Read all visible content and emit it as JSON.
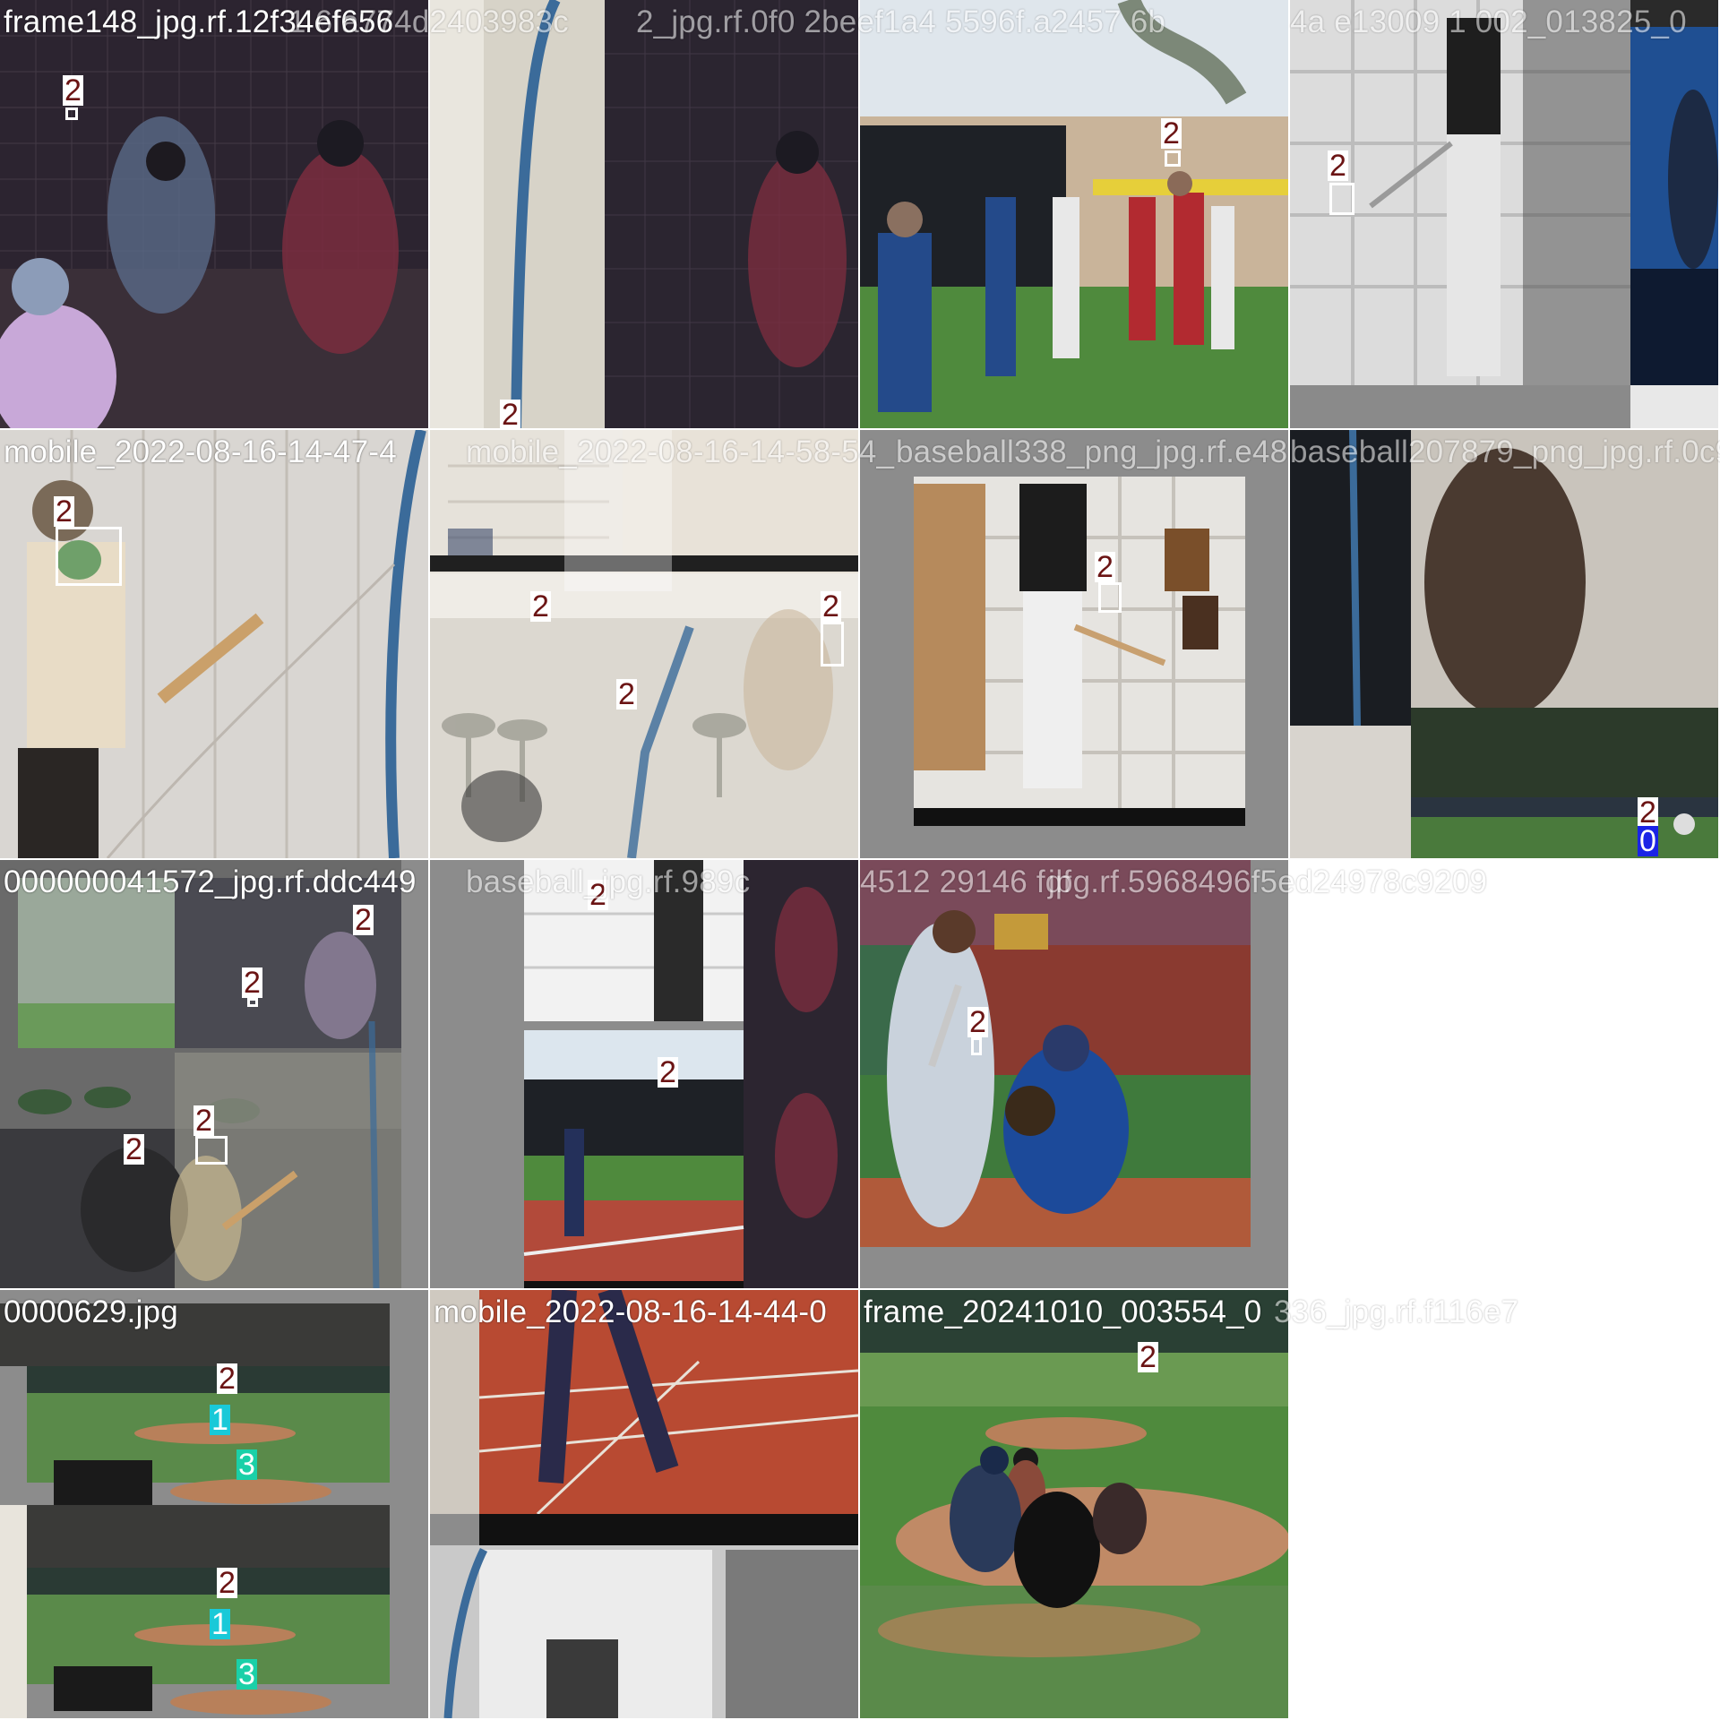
{
  "colors": {
    "class_2": "#ffffff",
    "class_2_text": "#6b1414",
    "class_0": "#1a24e6",
    "class_1": "#19c9d8",
    "class_3": "#1ad0a8",
    "pad_gray": "#8c8c8c"
  },
  "classes": {
    "c0": "0",
    "c1": "1",
    "c2": "2",
    "c3": "3"
  },
  "tiles": [
    {
      "filename": "frame148_jpg.rf.12f34ef656",
      "ghost": "1 6fa774d2403983c"
    },
    {
      "filename": "",
      "ghost": "2_jpg.rf.0f0 2beef1a4 5596f.a2457 6b"
    },
    {
      "filename": "",
      "ghost": "4a e13009 1 002_013825_0"
    },
    {
      "filename": "",
      "ghost": ""
    },
    {
      "filename": "mobile_2022-08-16-14-47-4",
      "ghost": "mobile_2022-08-16-14-58-54_"
    },
    {
      "filename": "",
      "ghost": "baseball338_png_jpg.rf.e48"
    },
    {
      "filename": "",
      "ghost": "baseball207879_png_jpg.rf.0c9"
    },
    {
      "filename": "",
      "ghost": ""
    },
    {
      "filename": "000000041572_jpg.rf.ddc449",
      "ghost": "baseball_jpg.rf.989c"
    },
    {
      "filename": "",
      "ghost": "4512 29146 fdf"
    },
    {
      "filename": "",
      "ghost": "jpg.rf.5968496f5ed24978c9209"
    },
    {
      "filename": "",
      "ghost": ""
    },
    {
      "filename": "0000629.jpg",
      "ghost": ""
    },
    {
      "filename": "mobile_2022-08-16-14-44-0",
      "ghost": ""
    },
    {
      "filename": "frame_20241010_003554_0",
      "ghost": "336_jpg.rf.f116e7"
    },
    {
      "filename": "",
      "ghost": ""
    }
  ]
}
